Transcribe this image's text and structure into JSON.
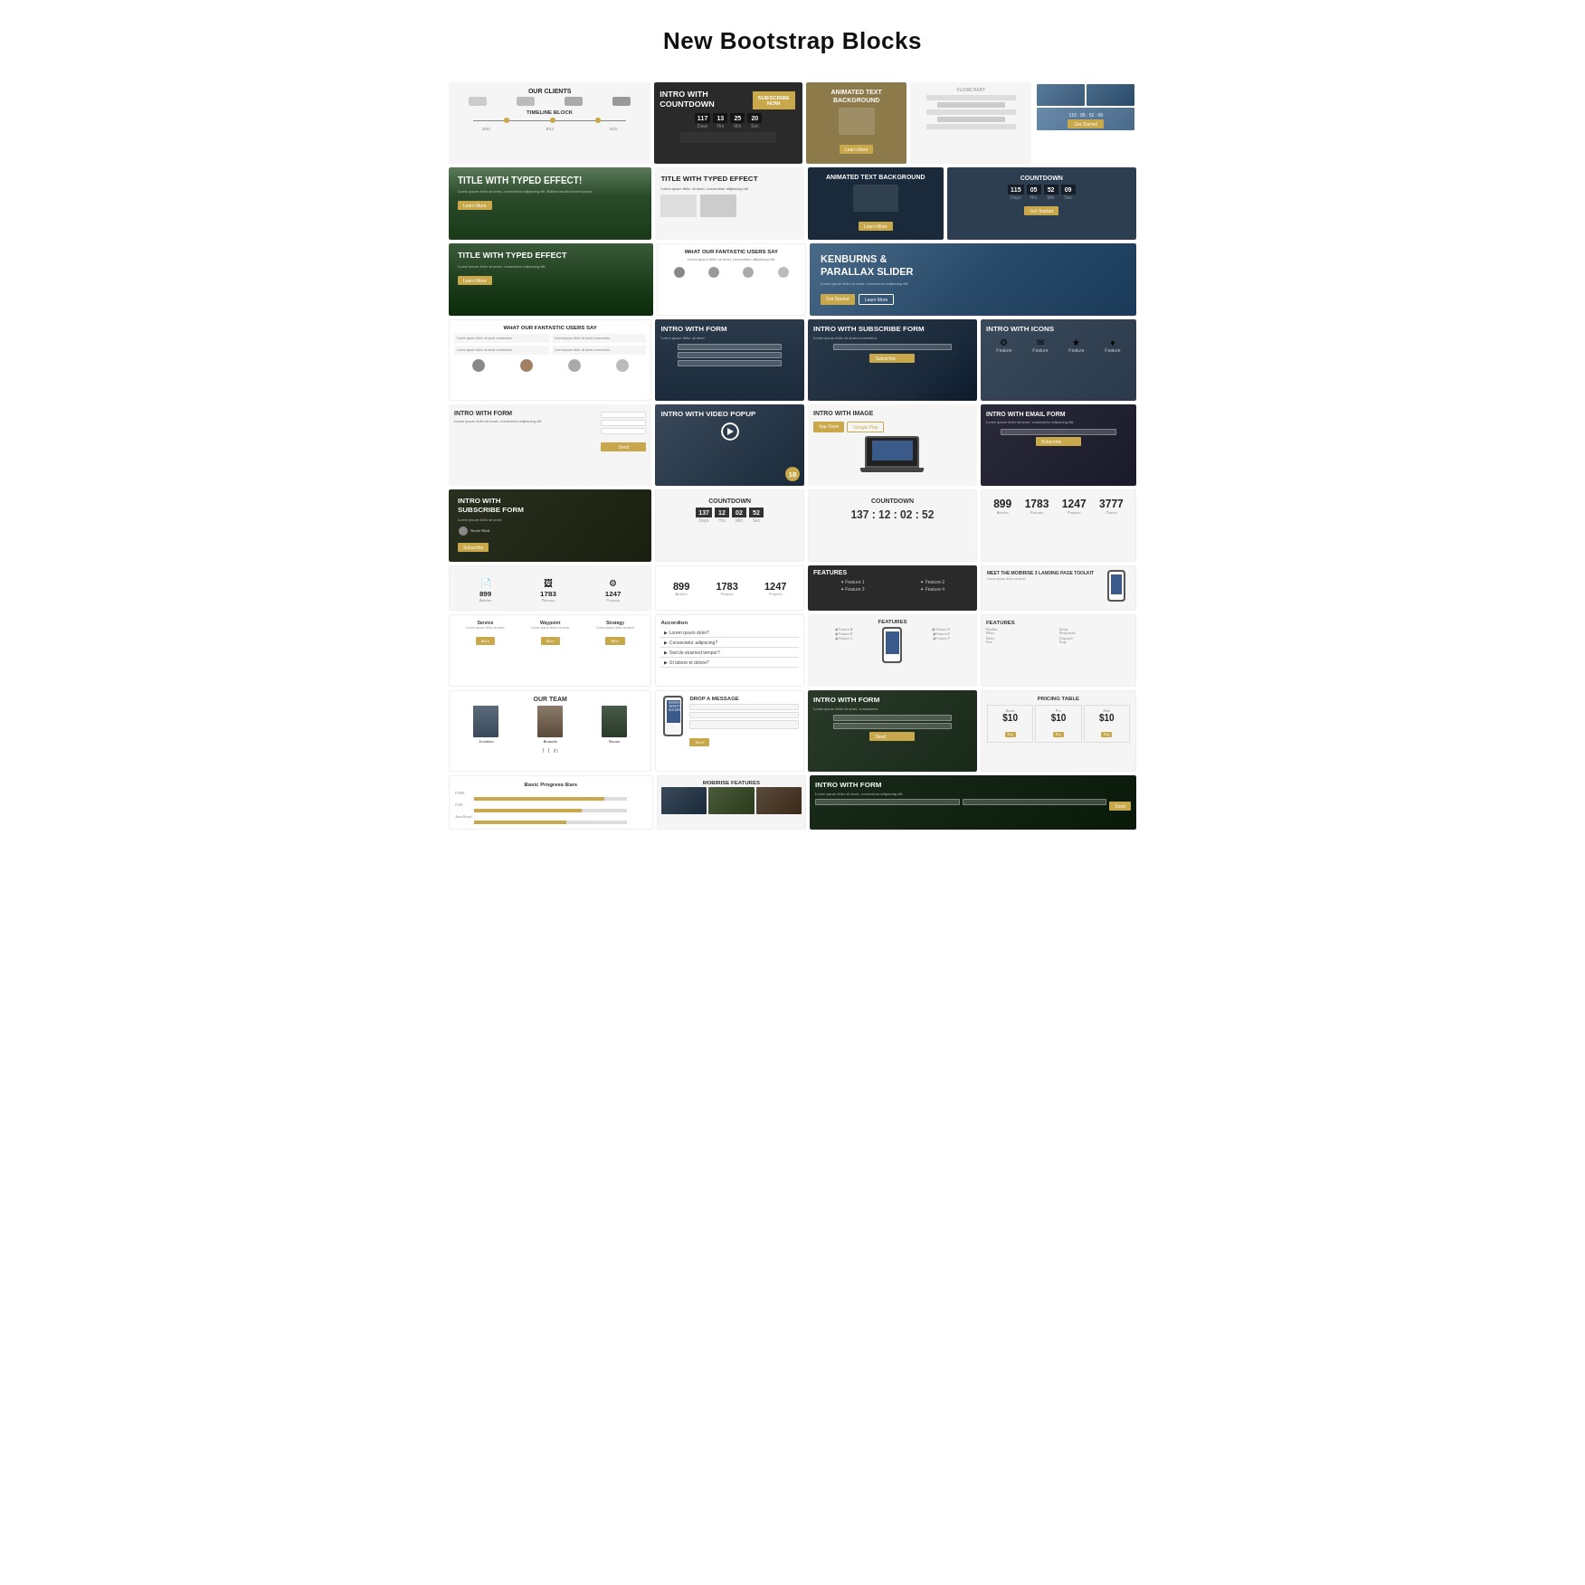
{
  "page": {
    "title": "New Bootstrap Blocks"
  },
  "blocks": {
    "row1": [
      {
        "id": "our-clients",
        "label": "OUR CLIENTS",
        "size": "md",
        "color": "dark",
        "bg": "light",
        "width": "32%"
      },
      {
        "id": "intro-countdown",
        "label": "INTRO WITH COUNTDOWN",
        "size": "md",
        "color": "white",
        "bg": "dark",
        "width": "24%"
      },
      {
        "id": "subscribe-now",
        "label": "SUBSCRIBE NOW",
        "size": "sm",
        "color": "white",
        "bg": "gold",
        "width": "8%"
      },
      {
        "id": "flowchart",
        "label": "",
        "size": "sm",
        "color": "dark",
        "bg": "light",
        "width": "20%"
      },
      {
        "id": "photo-grid-top",
        "label": "",
        "size": "sm",
        "color": "dark",
        "bg": "light",
        "width": "16%"
      }
    ],
    "row2": [
      {
        "id": "timeline",
        "label": "TIMELINE BLOCK",
        "size": "sm",
        "color": "dark",
        "bg": "light",
        "width": "32%"
      },
      {
        "id": "title-typed-1",
        "label": "TITLE WITH TYPED EFFECT!",
        "size": "md",
        "color": "white",
        "bg": "mountain",
        "width": "24%"
      },
      {
        "id": "title-typed-2",
        "label": "TITLE WITH TYPED EFFECT",
        "size": "sm",
        "color": "dark",
        "bg": "light2",
        "width": "20%"
      },
      {
        "id": "countdown-dark",
        "label": "",
        "size": "sm",
        "color": "white",
        "bg": "dark",
        "width": "24%"
      }
    ],
    "row3": [
      {
        "id": "animated-text-bg",
        "label": "ANIMATED TEXT BACKGROUND",
        "size": "sm",
        "color": "white",
        "bg": "olive",
        "width": "16%"
      },
      {
        "id": "title-typed-wide",
        "label": "TITLE WITH TYPED EFFECT",
        "size": "md",
        "color": "dark",
        "bg": "light",
        "width": "32%"
      },
      {
        "id": "animated-text-bg2",
        "label": "ANIMATED TEXT BACKGROUND",
        "size": "sm",
        "color": "dark",
        "bg": "lightgray",
        "width": "24%"
      }
    ],
    "row4": [
      {
        "id": "users-say-1",
        "label": "WHAT OUR FANTASTIC USERS SAY",
        "size": "sm",
        "color": "dark",
        "bg": "white",
        "width": "32%"
      },
      {
        "id": "users-say-2",
        "label": "WHAT OUR FANTASTIC USERS SAY",
        "size": "sm",
        "color": "dark",
        "bg": "white",
        "width": "24%"
      },
      {
        "id": "kenburns",
        "label": "KENBURNS & PARALLAX SLIDER",
        "size": "md",
        "color": "white",
        "bg": "sky",
        "width": "24%"
      }
    ],
    "countdowns": {
      "label1": "COUNTDOWN",
      "values1": [
        "117",
        "13",
        "25",
        "20"
      ],
      "label2": "COUNTDOWN",
      "values2": [
        "137",
        "12",
        "02",
        "52"
      ]
    },
    "stats": {
      "items": [
        {
          "num": "899",
          "label": "Articles"
        },
        {
          "num": "1783",
          "label": "Pictures"
        },
        {
          "num": "1247",
          "label": "Projects"
        },
        {
          "num": "3777",
          "label": "Clients"
        }
      ]
    }
  }
}
